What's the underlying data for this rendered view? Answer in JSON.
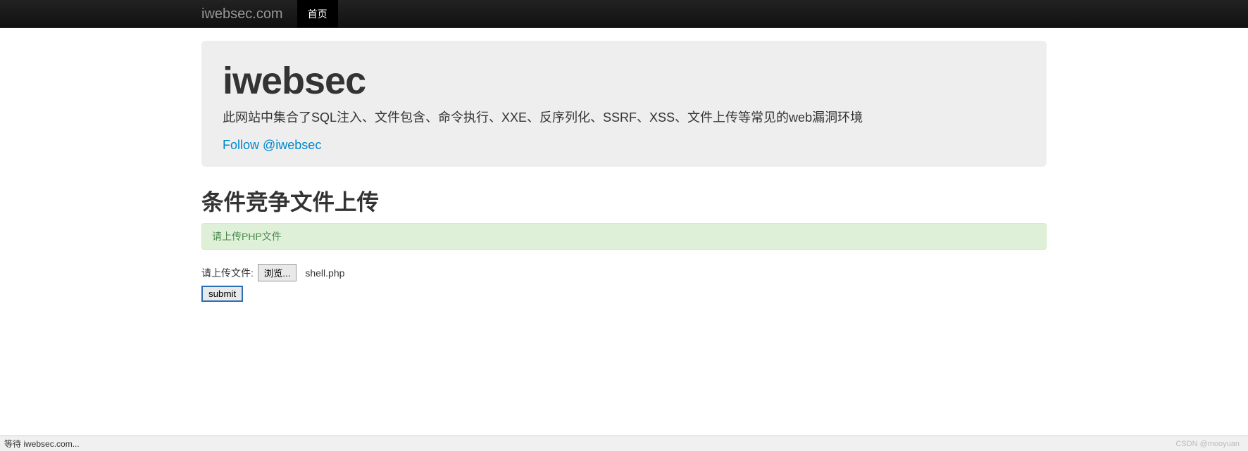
{
  "navbar": {
    "brand": "iwebsec.com",
    "home": "首页"
  },
  "hero": {
    "title": "iwebsec",
    "subtitle": "此网站中集合了SQL注入、文件包含、命令执行、XXE、反序列化、SSRF、XSS、文件上传等常见的web漏洞环境",
    "follow": "Follow @iwebsec"
  },
  "page": {
    "heading": "条件竞争文件上传"
  },
  "alert": {
    "text": "请上传PHP文件"
  },
  "form": {
    "label": "请上传文件:",
    "browse": "浏览...",
    "filename": "shell.php",
    "submit": "submit"
  },
  "status": {
    "loading": "等待 iwebsec.com...",
    "watermark": "CSDN @mooyuan"
  }
}
